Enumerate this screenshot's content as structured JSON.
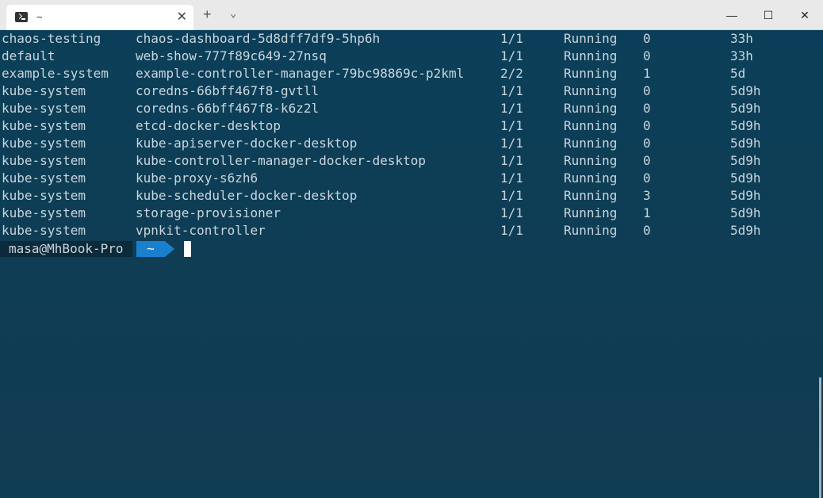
{
  "tab": {
    "title": "~",
    "close": "✕"
  },
  "titlebar": {
    "new_tab": "+",
    "dropdown": "⌄",
    "minimize": "—",
    "maximize": "☐",
    "close": "✕"
  },
  "rows": [
    {
      "ns": "chaos-testing",
      "name": "chaos-dashboard-5d8dff7df9-5hp6h",
      "ready": "1/1",
      "status": "Running",
      "restarts": "0",
      "age": "33h"
    },
    {
      "ns": "default",
      "name": "web-show-777f89c649-27nsq",
      "ready": "1/1",
      "status": "Running",
      "restarts": "0",
      "age": "33h"
    },
    {
      "ns": "example-system",
      "name": "example-controller-manager-79bc98869c-p2kml",
      "ready": "2/2",
      "status": "Running",
      "restarts": "1",
      "age": "5d"
    },
    {
      "ns": "kube-system",
      "name": "coredns-66bff467f8-gvtll",
      "ready": "1/1",
      "status": "Running",
      "restarts": "0",
      "age": "5d9h"
    },
    {
      "ns": "kube-system",
      "name": "coredns-66bff467f8-k6z2l",
      "ready": "1/1",
      "status": "Running",
      "restarts": "0",
      "age": "5d9h"
    },
    {
      "ns": "kube-system",
      "name": "etcd-docker-desktop",
      "ready": "1/1",
      "status": "Running",
      "restarts": "0",
      "age": "5d9h"
    },
    {
      "ns": "kube-system",
      "name": "kube-apiserver-docker-desktop",
      "ready": "1/1",
      "status": "Running",
      "restarts": "0",
      "age": "5d9h"
    },
    {
      "ns": "kube-system",
      "name": "kube-controller-manager-docker-desktop",
      "ready": "1/1",
      "status": "Running",
      "restarts": "0",
      "age": "5d9h"
    },
    {
      "ns": "kube-system",
      "name": "kube-proxy-s6zh6",
      "ready": "1/1",
      "status": "Running",
      "restarts": "0",
      "age": "5d9h"
    },
    {
      "ns": "kube-system",
      "name": "kube-scheduler-docker-desktop",
      "ready": "1/1",
      "status": "Running",
      "restarts": "3",
      "age": "5d9h"
    },
    {
      "ns": "kube-system",
      "name": "storage-provisioner",
      "ready": "1/1",
      "status": "Running",
      "restarts": "1",
      "age": "5d9h"
    },
    {
      "ns": "kube-system",
      "name": "vpnkit-controller",
      "ready": "1/1",
      "status": "Running",
      "restarts": "0",
      "age": "5d9h"
    }
  ],
  "prompt": {
    "user": "masa@MhBook-Pro",
    "dir": "~"
  },
  "colors": {
    "terminal_bg": "#0f3d54",
    "prompt_user_bg": "#0b2a3a",
    "prompt_dir_bg": "#1a7fcf"
  }
}
